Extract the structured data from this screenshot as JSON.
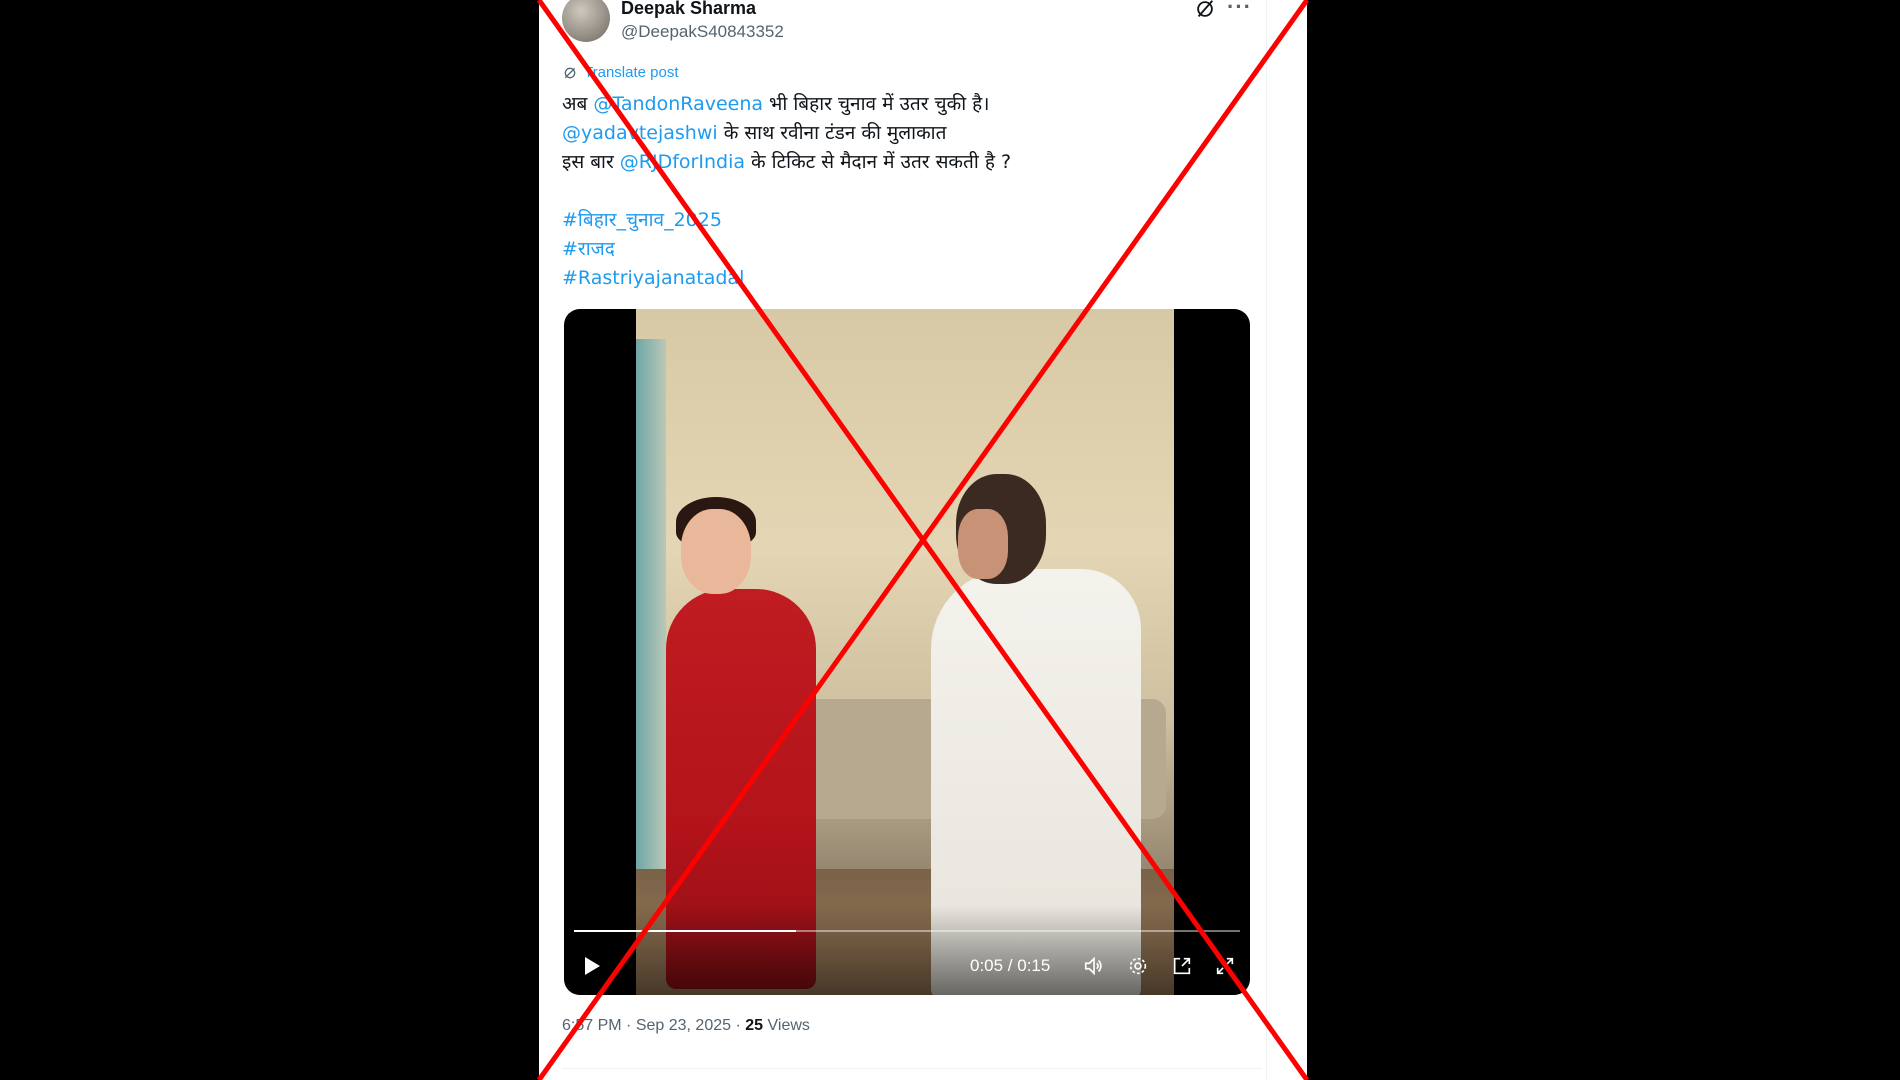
{
  "post": {
    "author": {
      "display_name": "Deepak Sharma",
      "handle": "@DeepakS40843352"
    },
    "translate_label": "Translate post",
    "text": {
      "line1": {
        "pre": "अब ",
        "mention": "@TandonRaveena",
        "post": " भी बिहार चुनाव में उतर चुकी है।"
      },
      "line2": {
        "mention": "@yadavtejashwi",
        "post": " के साथ रवीना टंडन की मुलाकात"
      },
      "line3": {
        "pre": "इस बार ",
        "mention": "@RJDforIndia",
        "post": " के टिकिट से मैदान में उतर सकती है ?"
      },
      "hashtags": [
        "#बिहार_चुनाव_2025",
        "#राजद",
        "#Rastriyajanatadal"
      ]
    },
    "video": {
      "time_display": "0:05 / 0:15",
      "progress_fraction": 0.333
    },
    "meta": {
      "time": "6:57 PM",
      "separator": "·",
      "date": "Sep 23, 2025",
      "views_count": "25",
      "views_label": "Views"
    }
  },
  "icons": {
    "grok": "grok-icon",
    "more": "more-icon",
    "translate": "translate-icon",
    "play": "play-icon",
    "volume": "volume-icon",
    "settings": "gear-icon",
    "pip": "pip-icon",
    "fullscreen": "fullscreen-icon"
  },
  "colors": {
    "link": "#1d9bf0",
    "text": "#0f1419",
    "secondary": "#536471",
    "overlay_cross": "#ff0000"
  }
}
